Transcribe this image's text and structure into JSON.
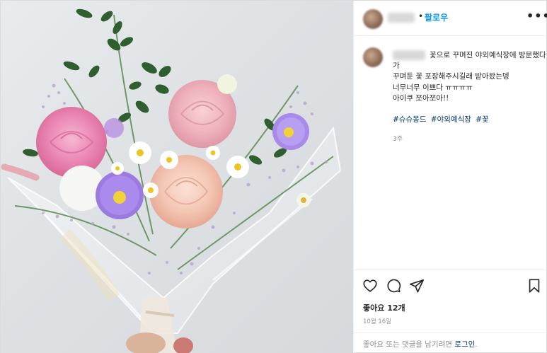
{
  "header": {
    "separator": "•",
    "follow_label": "팔로우",
    "more_label": "•••"
  },
  "comment": {
    "line1": "꽃으로 꾸며진 야외예식장에 방문했다",
    "line2": "가",
    "line3": "꾸며둔 꽃 포장해주시길래 받아왔는뎅",
    "line4": "너무너무 이쁘다 ㅠㅠㅠㅠ",
    "line5": "아이쿠 쪼아쪼아!!",
    "hashtags": [
      "#슈슈몽드",
      "#야외예식장",
      "#꽃"
    ],
    "time_ago": "3주"
  },
  "actions": {
    "like_icon": "heart-icon",
    "comment_icon": "comment-icon",
    "share_icon": "share-icon",
    "save_icon": "bookmark-icon"
  },
  "likes_text": "좋아요 12개",
  "date_text": "10월 16일",
  "footer": {
    "prompt": "좋아요 또는 댓글을 남기려면 ",
    "login_label": "로그인",
    "suffix": "."
  },
  "colors": {
    "follow_blue": "#0095f6",
    "link_navy": "#00376b",
    "muted_gray": "#8e8e8e",
    "text": "#262626",
    "border": "#efefef"
  }
}
